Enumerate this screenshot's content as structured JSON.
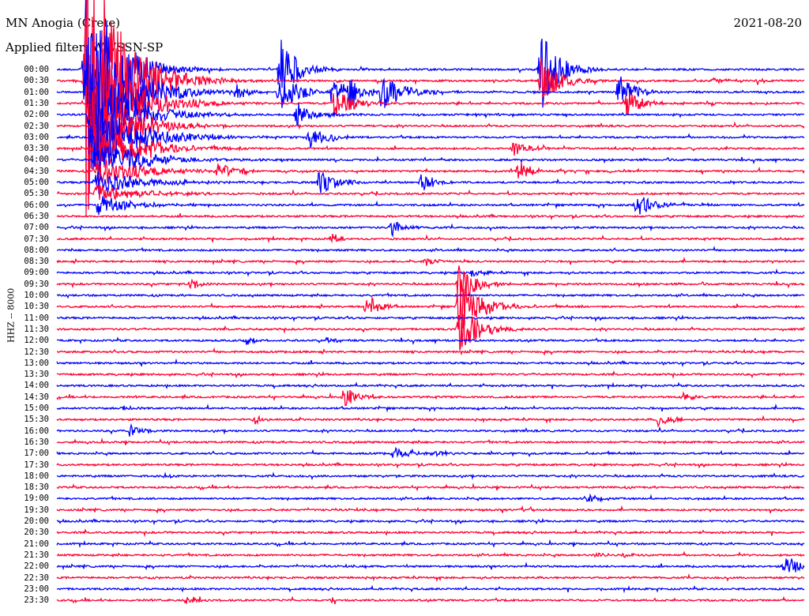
{
  "header": {
    "station": "MN Anogia (Crete)",
    "filter": "Applied filter: WWSSN-SP",
    "date": "2021-08-20"
  },
  "chart_data": {
    "type": "line",
    "ylabel": "HHZ -- 8000",
    "minutes_per_row": 30,
    "row_labels": [
      "00:00",
      "00:30",
      "01:00",
      "01:30",
      "02:00",
      "02:30",
      "03:00",
      "03:30",
      "04:00",
      "04:30",
      "05:00",
      "05:30",
      "06:00",
      "06:30",
      "07:00",
      "07:30",
      "08:00",
      "08:30",
      "09:00",
      "09:30",
      "10:00",
      "10:30",
      "11:00",
      "11:30",
      "12:00",
      "12:30",
      "13:00",
      "13:30",
      "14:00",
      "14:30",
      "15:00",
      "15:30",
      "16:00",
      "16:30",
      "17:00",
      "17:30",
      "18:00",
      "18:30",
      "19:00",
      "19:30",
      "20:00",
      "20:30",
      "21:00",
      "21:30",
      "22:00",
      "22:30",
      "23:00",
      "23:30"
    ],
    "trace_colors": [
      "#0000ff",
      "#ff0033"
    ],
    "events": [
      {
        "row": 0,
        "minute": 1.0,
        "amp": 30,
        "dur": 3
      },
      {
        "row": 1,
        "minute": 1.0,
        "amp": 30,
        "dur": 4
      },
      {
        "row": 2,
        "minute": 1.1,
        "amp": 20,
        "dur": 4
      },
      {
        "row": 3,
        "minute": 1.2,
        "amp": 16,
        "dur": 4
      },
      {
        "row": 4,
        "minute": 1.2,
        "amp": 12,
        "dur": 4
      },
      {
        "row": 5,
        "minute": 1.3,
        "amp": 9,
        "dur": 4
      },
      {
        "row": 6,
        "minute": 1.3,
        "amp": 7,
        "dur": 5
      },
      {
        "row": 7,
        "minute": 1.4,
        "amp": 5,
        "dur": 5
      },
      {
        "row": 8,
        "minute": 1.4,
        "amp": 4,
        "dur": 5
      },
      {
        "row": 9,
        "minute": 1.4,
        "amp": 3,
        "dur": 5
      },
      {
        "row": 10,
        "minute": 1.4,
        "amp": 2.5,
        "dur": 5
      },
      {
        "row": 11,
        "minute": 1.4,
        "amp": 2,
        "dur": 5
      },
      {
        "row": 12,
        "minute": 1.5,
        "amp": 2,
        "dur": 4
      },
      {
        "row": 0,
        "minute": 8.8,
        "amp": 8,
        "dur": 2
      },
      {
        "row": 2,
        "minute": 8.8,
        "amp": 5,
        "dur": 2
      },
      {
        "row": 4,
        "minute": 9.5,
        "amp": 3,
        "dur": 2
      },
      {
        "row": 6,
        "minute": 10.0,
        "amp": 2.5,
        "dur": 2
      },
      {
        "row": 0,
        "minute": 19.3,
        "amp": 9,
        "dur": 2
      },
      {
        "row": 1,
        "minute": 19.3,
        "amp": 6,
        "dur": 2
      },
      {
        "row": 2,
        "minute": 7.0,
        "amp": 2,
        "dur": 1.5
      },
      {
        "row": 2,
        "minute": 10.9,
        "amp": 3,
        "dur": 2
      },
      {
        "row": 3,
        "minute": 11.0,
        "amp": 4,
        "dur": 2
      },
      {
        "row": 2,
        "minute": 11.6,
        "amp": 3,
        "dur": 2
      },
      {
        "row": 2,
        "minute": 12.9,
        "amp": 4,
        "dur": 2.5
      },
      {
        "row": 2,
        "minute": 22.4,
        "amp": 4,
        "dur": 2
      },
      {
        "row": 3,
        "minute": 22.7,
        "amp": 3,
        "dur": 2
      },
      {
        "row": 1,
        "minute": 26.2,
        "amp": 0.6,
        "dur": 1.5
      },
      {
        "row": 1,
        "minute": 28.0,
        "amp": 1.2,
        "dur": 1
      },
      {
        "row": 7,
        "minute": 3.1,
        "amp": 2,
        "dur": 1.5
      },
      {
        "row": 8,
        "minute": 2.8,
        "amp": 1.5,
        "dur": 1.5
      },
      {
        "row": 9,
        "minute": 6.3,
        "amp": 2.5,
        "dur": 1.5
      },
      {
        "row": 9,
        "minute": 7.2,
        "amp": 1,
        "dur": 1
      },
      {
        "row": 10,
        "minute": 10.4,
        "amp": 3,
        "dur": 2
      },
      {
        "row": 7,
        "minute": 18.2,
        "amp": 2,
        "dur": 1.5
      },
      {
        "row": 9,
        "minute": 18.4,
        "amp": 2.5,
        "dur": 1.5
      },
      {
        "row": 10,
        "minute": 14.5,
        "amp": 2.5,
        "dur": 1.5
      },
      {
        "row": 12,
        "minute": 23.1,
        "amp": 3,
        "dur": 2
      },
      {
        "row": 14,
        "minute": 13.3,
        "amp": 2,
        "dur": 1.5
      },
      {
        "row": 15,
        "minute": 10.9,
        "amp": 1.5,
        "dur": 1
      },
      {
        "row": 17,
        "minute": 14.7,
        "amp": 1.5,
        "dur": 1
      },
      {
        "row": 18,
        "minute": 16.5,
        "amp": 1,
        "dur": 1.5
      },
      {
        "row": 19,
        "minute": 5.2,
        "amp": 1.2,
        "dur": 1.5
      },
      {
        "row": 19,
        "minute": 16.0,
        "amp": 5,
        "dur": 2
      },
      {
        "row": 21,
        "minute": 16.0,
        "amp": 6,
        "dur": 2.5
      },
      {
        "row": 23,
        "minute": 16.0,
        "amp": 5,
        "dur": 2.5
      },
      {
        "row": 21,
        "minute": 12.3,
        "amp": 3,
        "dur": 1.5
      },
      {
        "row": 24,
        "minute": 7.5,
        "amp": 1.2,
        "dur": 1.2
      },
      {
        "row": 24,
        "minute": 10.7,
        "amp": 0.8,
        "dur": 1.2
      },
      {
        "row": 29,
        "minute": 11.4,
        "amp": 2.5,
        "dur": 1.5
      },
      {
        "row": 30,
        "minute": 2.5,
        "amp": 1,
        "dur": 1
      },
      {
        "row": 32,
        "minute": 2.8,
        "amp": 2,
        "dur": 1.2
      },
      {
        "row": 31,
        "minute": 7.8,
        "amp": 1.5,
        "dur": 1
      },
      {
        "row": 29,
        "minute": 25.0,
        "amp": 1,
        "dur": 1.5
      },
      {
        "row": 31,
        "minute": 24.0,
        "amp": 2,
        "dur": 1.5
      },
      {
        "row": 34,
        "minute": 13.4,
        "amp": 1.5,
        "dur": 2
      },
      {
        "row": 34,
        "minute": 15.1,
        "amp": 0.8,
        "dur": 1.5
      },
      {
        "row": 36,
        "minute": 4.2,
        "amp": 0.8,
        "dur": 1
      },
      {
        "row": 38,
        "minute": 21.2,
        "amp": 1.2,
        "dur": 1.5
      },
      {
        "row": 39,
        "minute": 18.5,
        "amp": 0.8,
        "dur": 1
      },
      {
        "row": 43,
        "minute": 21.5,
        "amp": 1,
        "dur": 1
      },
      {
        "row": 43,
        "minute": 22.6,
        "amp": 0.8,
        "dur": 0.8
      },
      {
        "row": 44,
        "minute": 29.1,
        "amp": 3,
        "dur": 1.5
      },
      {
        "row": 45,
        "minute": 3.6,
        "amp": 0.6,
        "dur": 0.8
      },
      {
        "row": 47,
        "minute": 5.1,
        "amp": 1.5,
        "dur": 1
      },
      {
        "row": 47,
        "minute": 10.9,
        "amp": 0.8,
        "dur": 0.8
      }
    ]
  }
}
